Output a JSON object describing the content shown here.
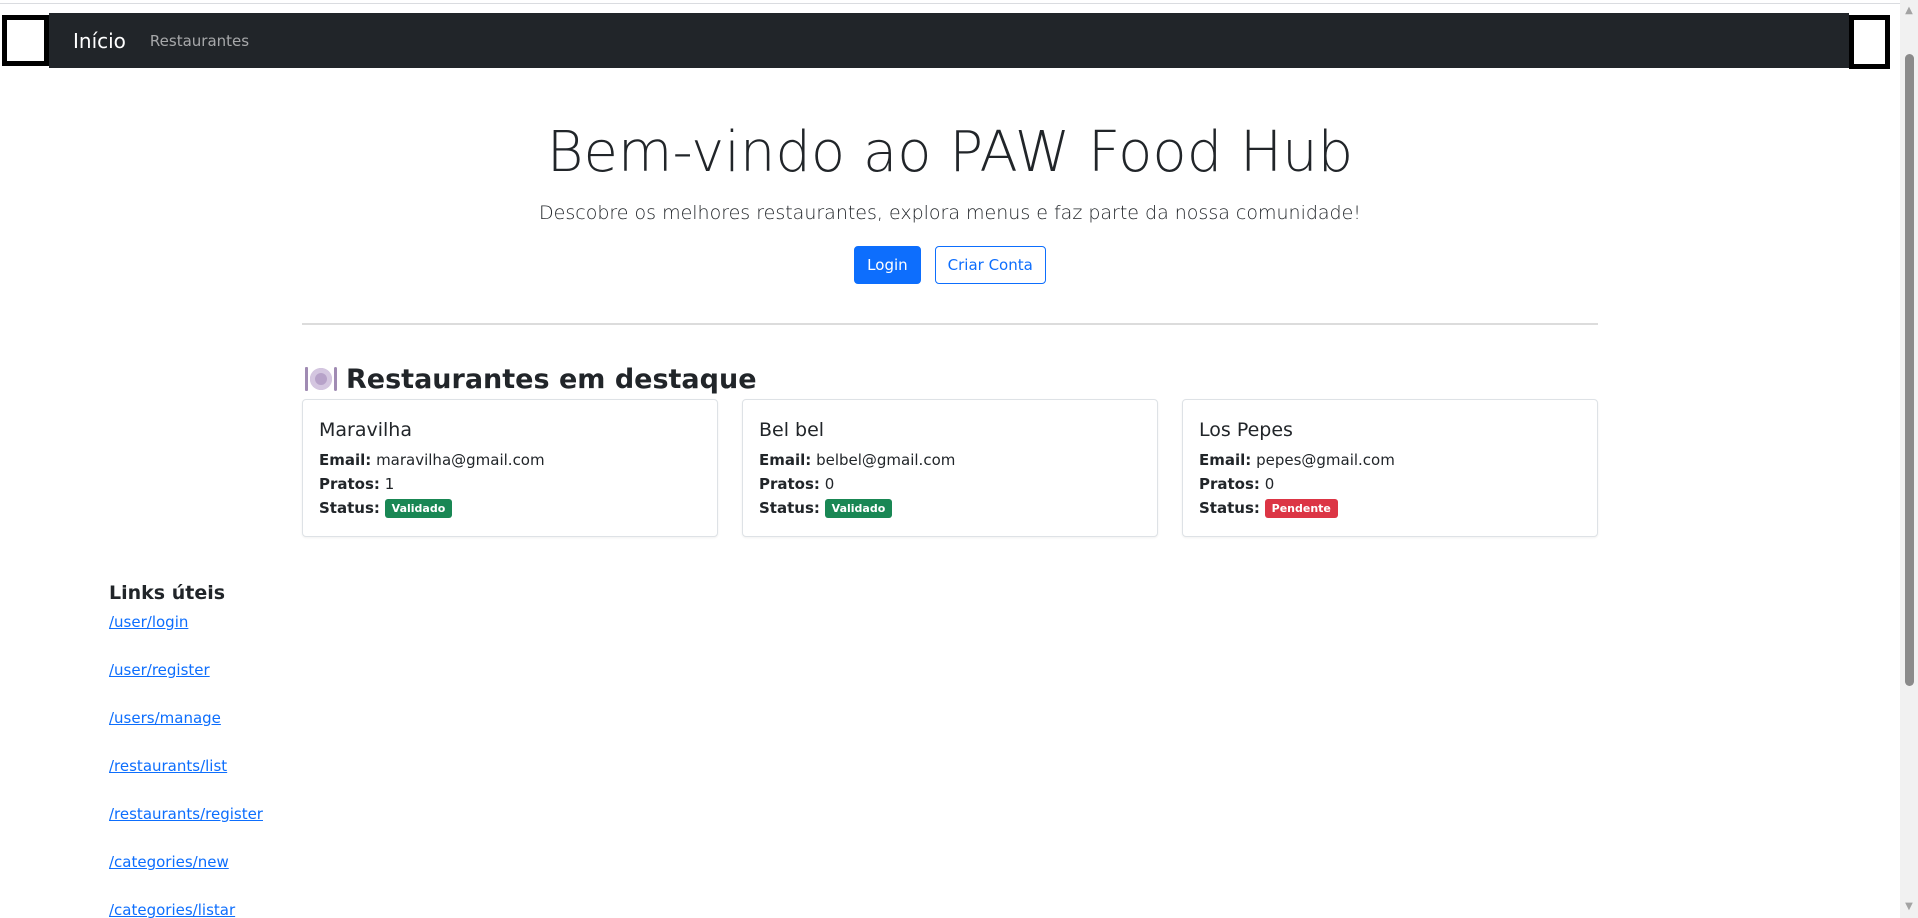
{
  "navbar": {
    "brand": "Início",
    "links": [
      "Restaurantes"
    ]
  },
  "hero": {
    "title": "Bem-vindo ao PAW Food Hub",
    "lead": "Descobre os melhores restaurantes, explora menus e faz parte da nossa comunidade!",
    "login_label": "Login",
    "register_label": "Criar Conta"
  },
  "featured": {
    "icon": "plate-with-cutlery-icon",
    "heading": "Restaurantes em destaque",
    "email_label": "Email:",
    "dishes_label": "Pratos:",
    "status_label": "Status:",
    "restaurants": [
      {
        "name": "Maravilha",
        "email": "maravilha@gmail.com",
        "dishes": "1",
        "status": "Validado",
        "status_color": "#198754"
      },
      {
        "name": "Bel bel",
        "email": "belbel@gmail.com",
        "dishes": "0",
        "status": "Validado",
        "status_color": "#198754"
      },
      {
        "name": "Los Pepes",
        "email": "pepes@gmail.com",
        "dishes": "0",
        "status": "Pendente",
        "status_color": "#dc3545"
      }
    ]
  },
  "useful_links": {
    "title": "Links úteis",
    "items": [
      "/user/login",
      "/user/register",
      "/users/manage",
      "/restaurants/list",
      "/restaurants/register",
      "/categories/new",
      "/categories/listar"
    ]
  },
  "colors": {
    "navbar_bg": "#212529",
    "primary": "#0d6efd",
    "success": "#198754",
    "danger": "#dc3545"
  }
}
